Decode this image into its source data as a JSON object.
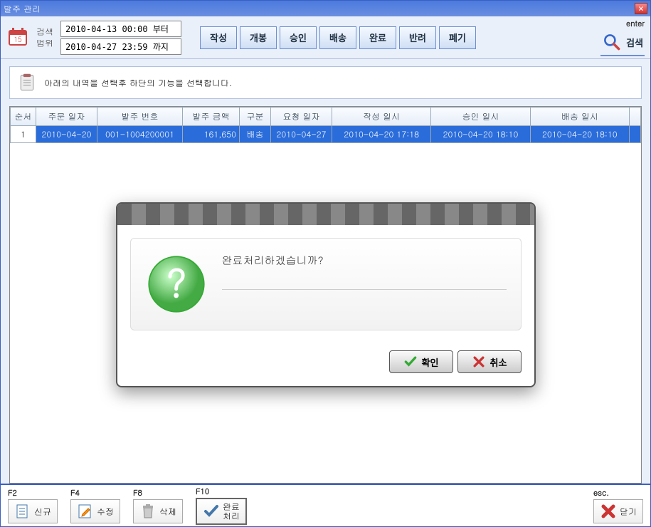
{
  "window": {
    "title": "발주 관리"
  },
  "toolbar": {
    "range_label_1": "검색",
    "range_label_2": "범위",
    "date_from": "2010-04-13 00:00 부터",
    "date_to": "2010-04-27 23:59 까지",
    "status_buttons": [
      "작성",
      "개봉",
      "승인",
      "배송",
      "완료",
      "반려",
      "폐기"
    ],
    "search_shortcut": "enter",
    "search_label": "검색"
  },
  "instruction": "아래의 내역을 선택후 하단의 기능을 선택합니다.",
  "table": {
    "headers": [
      "순서",
      "주문 일자",
      "발주 번호",
      "발주 금액",
      "구분",
      "요청 일자",
      "작성 일시",
      "승인 일시",
      "배송 일시"
    ],
    "rows": [
      {
        "cells": [
          "1",
          "2010-04-20",
          "001-1004200001",
          "161,650",
          "배송",
          "2010-04-27",
          "2010-04-20 17:18",
          "2010-04-20 18:10",
          "2010-04-20 18:10"
        ],
        "selected": true
      }
    ]
  },
  "footer": {
    "buttons": [
      {
        "key": "F2",
        "label": "신규"
      },
      {
        "key": "F4",
        "label": "수정"
      },
      {
        "key": "F8",
        "label": "삭제"
      },
      {
        "key": "F10",
        "label": "완료\n처리",
        "big": true
      }
    ],
    "close": {
      "key": "esc.",
      "label": "닫기"
    }
  },
  "modal": {
    "message": "완료처리하겠습니까?",
    "ok": "확인",
    "cancel": "취소"
  }
}
